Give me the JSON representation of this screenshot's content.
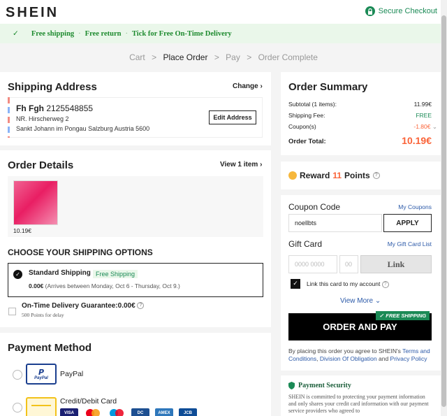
{
  "header": {
    "logo": "SHEIN",
    "secure_checkout": "Secure Checkout"
  },
  "banner": {
    "items": [
      "Free shipping",
      "Free return",
      "Tick for Free On-Time Delivery"
    ],
    "separator": "·"
  },
  "breadcrumb": {
    "steps": [
      "Cart",
      "Place Order",
      "Pay",
      "Order Complete"
    ],
    "separator": ">"
  },
  "shipping_address": {
    "title": "Shipping Address",
    "change_label": "Change",
    "name": "Fh Fgh",
    "phone": "2125548855",
    "line1": "NR. Hirscherweg 2",
    "line2": "Sankt Johann im Pongau Salzburg Austria 5600",
    "edit_label": "Edit Address"
  },
  "order_details": {
    "title": "Order Details",
    "view_label": "View 1 item",
    "item_price": "10.19€"
  },
  "shipping_options": {
    "title": "CHOOSE YOUR SHIPPING OPTIONS",
    "standard": {
      "label": "Standard Shipping",
      "tag": "Free Shipping",
      "price": "0.00€",
      "eta": "(Arrives between Monday, Oct 6 - Thursday, Oct 9.)"
    },
    "ontime": {
      "label": "On-Time Delivery Guarantee:0.00€",
      "sub": "500 Points for delay"
    }
  },
  "payment_method": {
    "title": "Payment Method",
    "paypal_label": "PayPal",
    "paypal_logo_top": "PayPal",
    "paypal_logo_bottom": "PayPal",
    "card_label": "Credit/Debit Card",
    "card_brands": [
      "VISA",
      "MC",
      "MAESTRO",
      "DC",
      "AMEX",
      "JCB"
    ]
  },
  "order_summary": {
    "title": "Order Summary",
    "rows": [
      {
        "label": "Subtotal (1 items):",
        "value": "11.99€"
      },
      {
        "label": "Shipping Fee:",
        "value": "FREE"
      },
      {
        "label": "Coupon(s)",
        "value": "-1.80€"
      }
    ],
    "total_label": "Order Total:",
    "total_value": "10.19€"
  },
  "reward": {
    "prefix": "Reward",
    "points": "11",
    "suffix": "Points"
  },
  "coupon": {
    "title": "Coupon Code",
    "my_coupons": "My Coupons",
    "value": "noellbts",
    "apply_label": "APPLY"
  },
  "gift_card": {
    "title": "Gift Card",
    "my_gift_card_list": "My Gift Card List",
    "number_placeholder": "0000 0000",
    "pin_placeholder": "00",
    "link_label": "Link",
    "link_account_label": "Link this card to my account",
    "view_more": "View More"
  },
  "order_button": {
    "label": "ORDER AND PAY",
    "tag": "FREE SHIPPING"
  },
  "terms": {
    "prefix": "By placing this order you agree to SHEIN's ",
    "terms_link": "Terms and Conditions",
    "comma": ", ",
    "division_link": "Division Of Obligation",
    "and": " and ",
    "privacy_link": "Privacy Policy"
  },
  "payment_security": {
    "title": "Payment Security",
    "text": "SHEIN is committed to protecting your payment information and only shares your credit card information with our payment service providers who agreed to"
  },
  "colors": {
    "accent_green": "#1b8a56",
    "price_red": "#fa6338",
    "link_blue": "#2b59a8"
  }
}
